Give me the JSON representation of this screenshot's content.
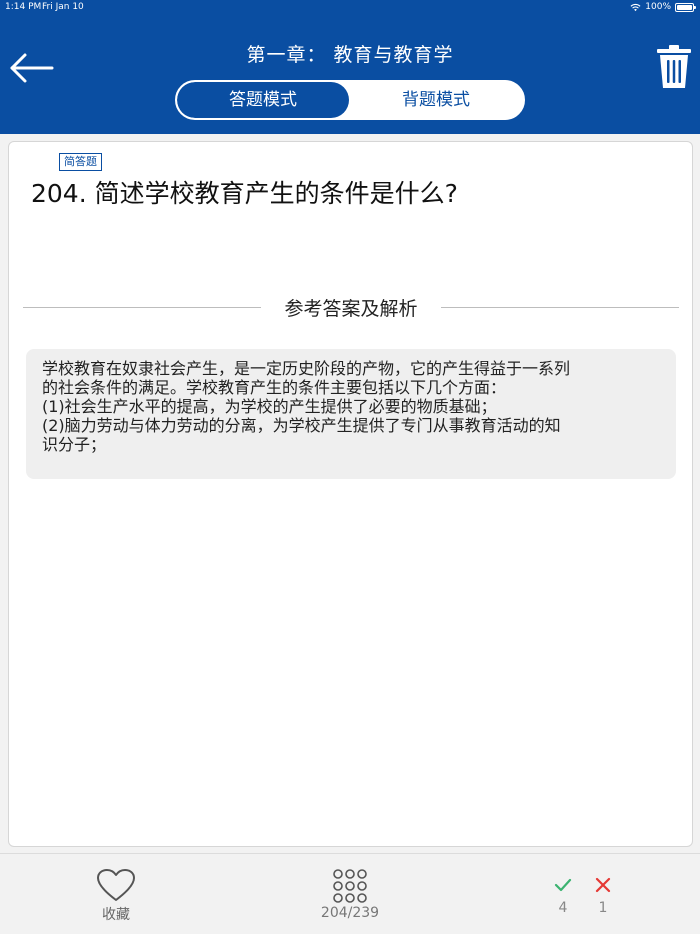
{
  "status_bar": {
    "time": "1:14 PM",
    "date": "Fri Jan 10",
    "battery": "100%"
  },
  "header": {
    "title": "第一章：  教育与教育学",
    "background_color": "#0a4ea2",
    "back_icon": "arrow-left-icon",
    "delete_icon": "trash-icon"
  },
  "mode_switch": {
    "tabs": [
      {
        "label": "答题模式",
        "active": true
      },
      {
        "label": "背题模式",
        "active": false
      }
    ]
  },
  "question": {
    "type_badge": "简答题",
    "text": "204. 简述学校教育产生的条件是什么?"
  },
  "answer_section": {
    "heading": "参考答案及解析",
    "lines": [
      "学校教育在奴隶社会产生，是一定历史阶段的产物，它的产生得益于一系列",
      "的社会条件的满足。学校教育产生的条件主要包括以下几个方面：",
      "(1)社会生产水平的提高，为学校的产生提供了必要的物质基础；",
      "(2)脑力劳动与体力劳动的分离，为学校产生提供了专门从事教育活动的知",
      "识分子；"
    ]
  },
  "bottom_bar": {
    "favorite_label": "收藏",
    "progress": "204/239",
    "correct_count": "4",
    "wrong_count": "1",
    "correct_color": "#3cb371",
    "wrong_color": "#e53935"
  }
}
